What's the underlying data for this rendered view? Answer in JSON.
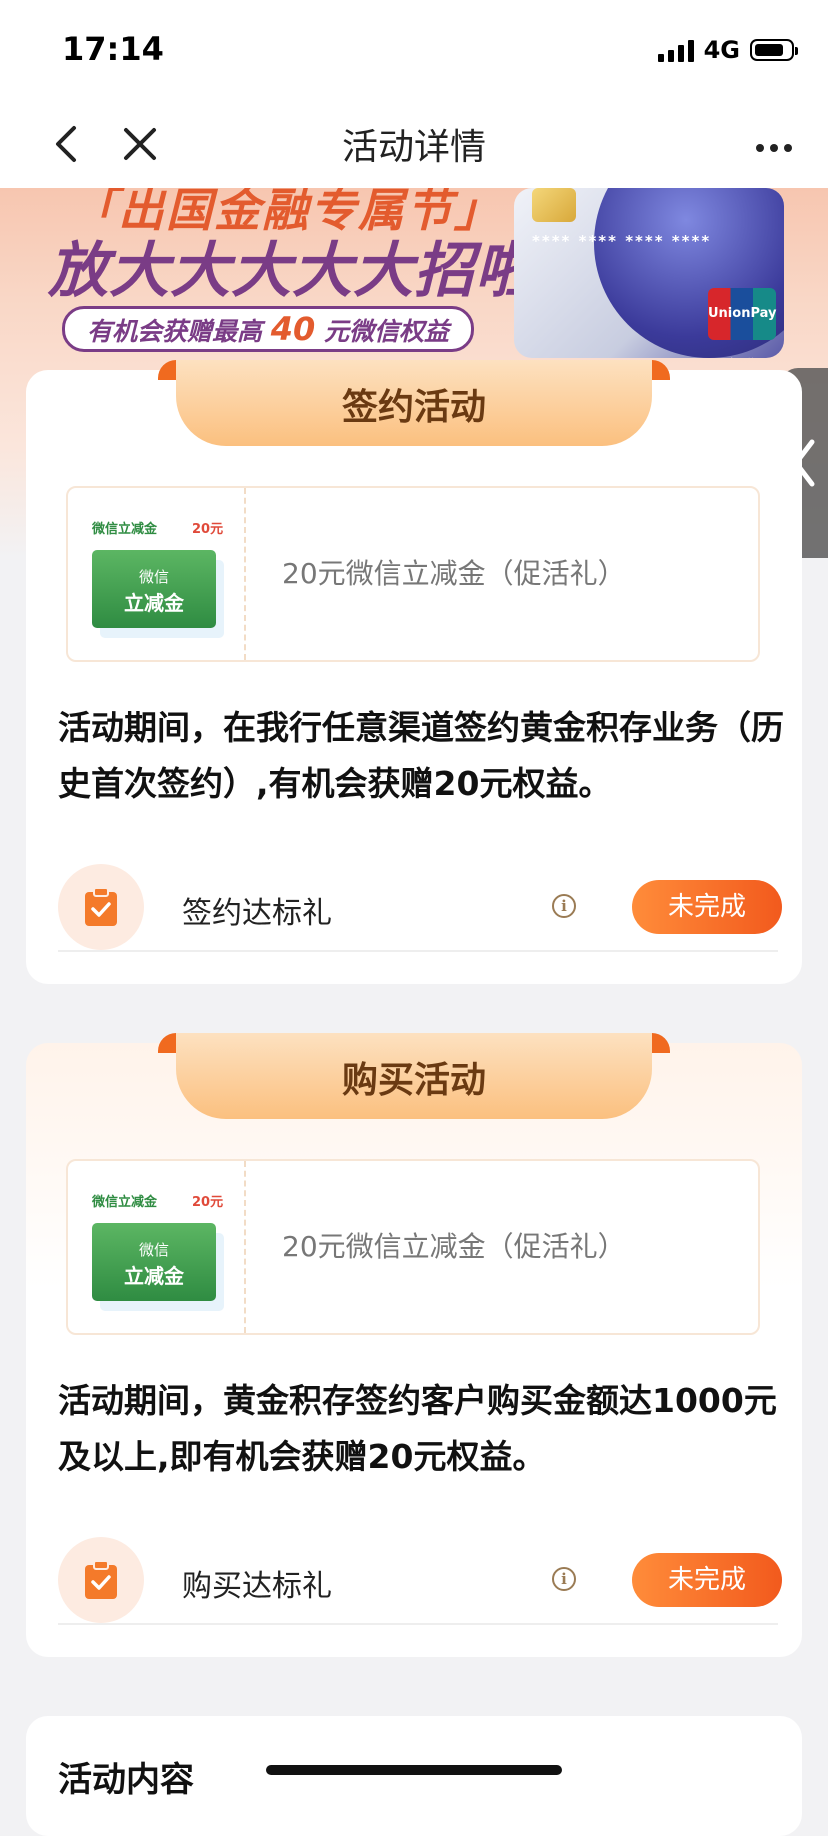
{
  "status_bar": {
    "time": "17:14",
    "network": "4G"
  },
  "nav": {
    "title": "活动详情"
  },
  "banner": {
    "headline_top": "「出国金融专属节」",
    "headline_main": "放大大大大大招啦！",
    "pill_prefix": "有机会获赠最高 ",
    "pill_amount": "40",
    "pill_suffix": " 元微信权益",
    "card_stars": "**** **** **** ****",
    "card_brand": "UnionPay 银联"
  },
  "sections": [
    {
      "header": "签约活动",
      "coupon": {
        "mini_title": "微信立减金",
        "mini_amount": "20元",
        "voucher_line1": "微信",
        "voucher_line2": "立减金",
        "desc": "20元微信立减金（促活礼）"
      },
      "text": "活动期间，在我行任意渠道签约黄金积存业务（历史首次签约）,有机会获赠20元权益。",
      "task": {
        "label": "签约达标礼",
        "status": "未完成"
      }
    },
    {
      "header": "购买活动",
      "coupon": {
        "mini_title": "微信立减金",
        "mini_amount": "20元",
        "voucher_line1": "微信",
        "voucher_line2": "立减金",
        "desc": "20元微信立减金（促活礼）"
      },
      "text": "活动期间，黄金积存签约客户购买金额达1000元及以上,即有机会获赠20元权益。",
      "task": {
        "label": "购买达标礼",
        "status": "未完成"
      }
    }
  ],
  "content": {
    "title": "活动内容"
  },
  "colors": {
    "accent": "#f25a1d",
    "header_tab": "#fbc07f",
    "voucher_green": "#2f8c42"
  }
}
